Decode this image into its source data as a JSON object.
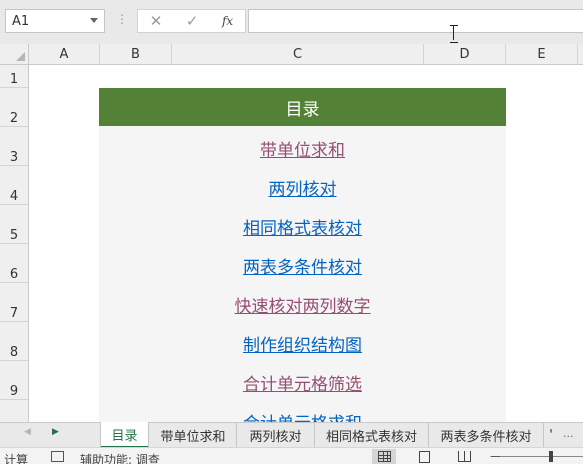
{
  "formula_bar": {
    "name_box": "A1",
    "cancel_symbol": "✕",
    "enter_symbol": "✓",
    "function_symbol": "fx",
    "formula": ""
  },
  "columns": [
    "A",
    "B",
    "C",
    "D",
    "E"
  ],
  "rows": [
    "1",
    "2",
    "3",
    "4",
    "5",
    "6",
    "7",
    "8",
    "9"
  ],
  "toc": {
    "title": "目录",
    "title_color": "#538135",
    "links": [
      {
        "label": "带单位求和",
        "visited": true
      },
      {
        "label": "两列核对",
        "visited": false
      },
      {
        "label": "相同格式表核对",
        "visited": false
      },
      {
        "label": "两表多条件核对",
        "visited": false
      },
      {
        "label": "快速核对两列数字",
        "visited": true
      },
      {
        "label": "制作组织结构图",
        "visited": false
      },
      {
        "label": "合计单元格筛选",
        "visited": true
      },
      {
        "label": "合计单元格求和",
        "visited": false
      }
    ],
    "visited_color": "#954f72",
    "link_color": "#0563c1"
  },
  "sheet_tabs": {
    "tabs": [
      "目录",
      "带单位求和",
      "两列核对",
      "相同格式表核对",
      "两表多条件核对"
    ],
    "active": "目录",
    "more": "'",
    "more_menu": "...",
    "nav_prev": "◀",
    "nav_next": "▶"
  },
  "status_bar": {
    "mode": "计算",
    "accessibility": "辅助功能: 调查",
    "zoom_minus": "—"
  },
  "accent_color": "#217346"
}
